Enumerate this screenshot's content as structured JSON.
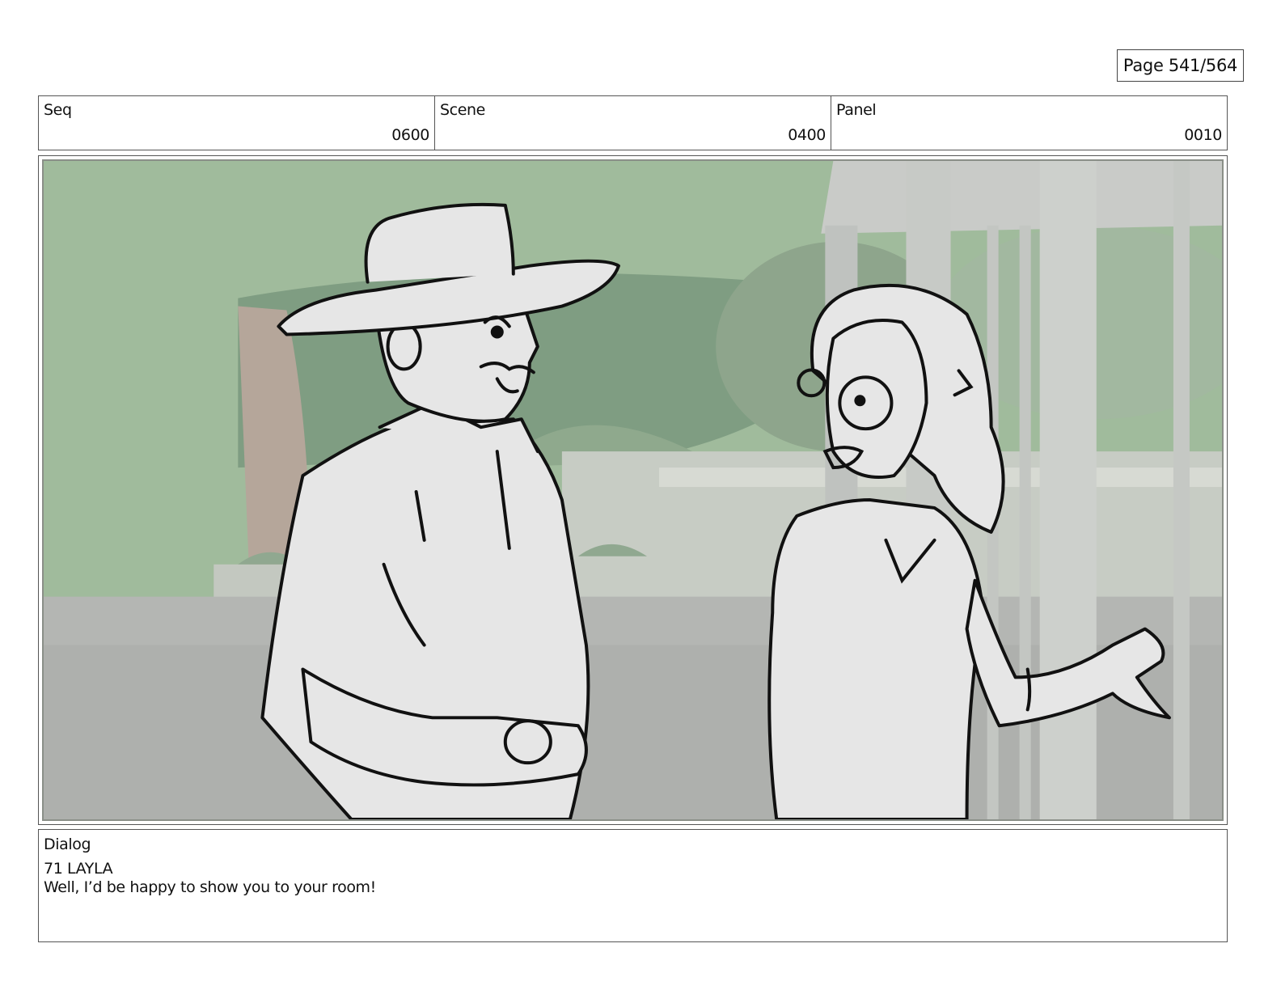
{
  "page": {
    "label": "Page 541/564"
  },
  "header": {
    "seq": {
      "label": "Seq",
      "value": "0600"
    },
    "scene": {
      "label": "Scene",
      "value": "0400"
    },
    "panel": {
      "label": "Panel",
      "value": "0010"
    }
  },
  "panel_image": {
    "icon": "storyboard-sketch-man-in-hat-and-girl-with-glasses"
  },
  "dialog": {
    "label": "Dialog",
    "speaker": "71 LAYLA",
    "line": "Well, I’d be happy to show you to your room!"
  },
  "colors": {
    "sky": "#9db89a",
    "building": "#c9cdc6",
    "ground": "#b7b8b6",
    "sketch_fill": "#e6e6e6",
    "ink": "#111111"
  }
}
